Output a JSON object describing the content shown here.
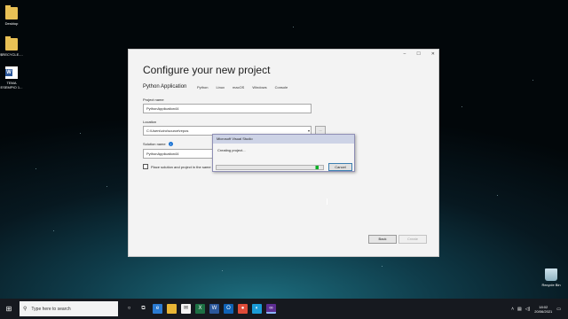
{
  "desktop": {
    "icons": [
      {
        "label": "Desktop",
        "icon": "folder-icon"
      },
      {
        "label": "$RECYCLE....",
        "icon": "folder-icon"
      },
      {
        "label": "TEMA ESEMPIO 1...",
        "icon": "word-document-icon"
      }
    ],
    "recycle_bin_label": "Recycle Bin"
  },
  "dialog": {
    "window_controls": [
      "–",
      "☐",
      "✕"
    ],
    "title": "Configure your new project",
    "project_type": "Python Application",
    "tags": [
      "Python",
      "Linux",
      "macOS",
      "Windows",
      "Console"
    ],
    "project_name_label": "Project name",
    "project_name_value": "PythonApplication44",
    "location_label": "Location",
    "location_value": "C:\\Users\\ciro\\source\\repos",
    "browse_label": "...",
    "solution_name_label": "Solution name",
    "solution_name_value": "PythonApplication44",
    "checkbox_label": "Place solution and project in the same directory",
    "back_label": "Back",
    "create_label": "Create"
  },
  "popup": {
    "title": "Microsoft Visual Studio",
    "status": "Creating project...",
    "progress": 0.96,
    "cancel_label": "Cancel"
  },
  "taskbar": {
    "search_placeholder": "Type here to search",
    "time": "18:02",
    "date": "20/06/2021",
    "icons": [
      "task-view-icon",
      "edge-icon",
      "file-explorer-icon",
      "mail-icon",
      "excel-icon",
      "word-icon",
      "outlook-icon",
      "chrome-icon",
      "edge-chromium-icon",
      "visual-studio-icon"
    ]
  },
  "colors": {
    "accent": "#5c2d91",
    "progress": "#06b025",
    "popup_title_bg": "#cdd3e6"
  }
}
